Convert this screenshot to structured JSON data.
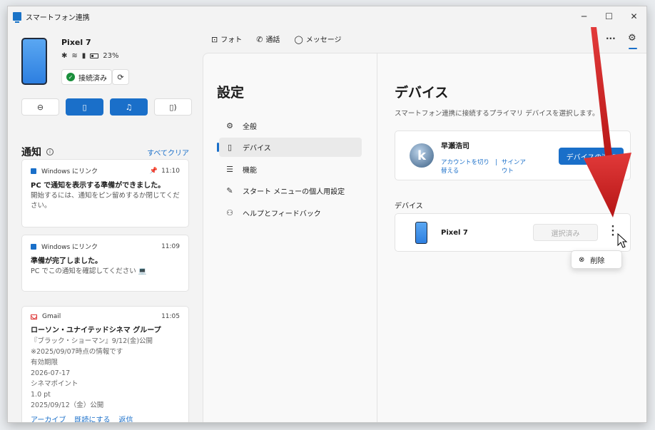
{
  "window": {
    "title": "スマートフォン連携",
    "minimize": "─",
    "maximize": "☐",
    "close": "✕"
  },
  "phone": {
    "name": "Pixel 7",
    "battery": "23%",
    "connected_label": "接続済み"
  },
  "quick_actions": [
    "⊖",
    "▯",
    "♫",
    "▯)"
  ],
  "notifications": {
    "title": "通知",
    "clear_all": "すべてクリア",
    "items": [
      {
        "app": "Windows にリンク",
        "time": "11:10",
        "title": "PC で通知を表示する準備ができました。",
        "body": "開始するには、通知をピン留めするか閉じてください。"
      },
      {
        "app": "Windows にリンク",
        "time": "11:09",
        "title": "準備が完了しました。",
        "body": "PC でこの通知を確認してください 💻"
      },
      {
        "app": "Gmail",
        "time": "11:05",
        "title": "ローソン・ユナイテッドシネマ グループ",
        "lines": [
          "『ブラック・ショーマン』9/12(金)公開",
          "※2025/09/07時点の情報です",
          "有効期限",
          "2026-07-17",
          "シネマポイント",
          "1.0 pt",
          "2025/09/12（金）公開"
        ],
        "actions": [
          "アーカイブ",
          "既読にする",
          "返信"
        ]
      }
    ]
  },
  "topnav": {
    "photos": "フォト",
    "calls": "通話",
    "messages": "メッセージ",
    "more": "···"
  },
  "settings": {
    "title": "設定",
    "nav": [
      {
        "label": "全般",
        "icon": "gear-icon"
      },
      {
        "label": "デバイス",
        "icon": "phone-icon"
      },
      {
        "label": "機能",
        "icon": "list-icon"
      },
      {
        "label": "スタート メニューの個人用設定",
        "icon": "pen-icon"
      },
      {
        "label": "ヘルプとフィードバック",
        "icon": "help-icon"
      }
    ],
    "main": {
      "title": "デバイス",
      "desc": "スマートフォン連携に接続するプライマリ デバイスを選択します。",
      "account_name": "早瀬浩司",
      "switch_account": "アカウントを切り替える",
      "sign_out": "サインアウト",
      "add_device": "デバイスの追加",
      "devices_section": "デバイス",
      "device_name": "Pixel 7",
      "selected": "選択済み",
      "delete": "削除"
    }
  },
  "colors": {
    "accent": "#1a6fc9",
    "annotation_arrow": "#d32020"
  }
}
